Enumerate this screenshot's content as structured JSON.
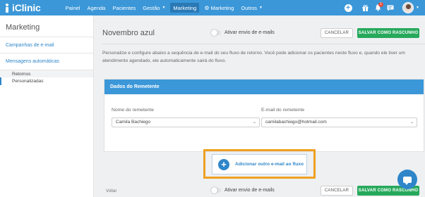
{
  "app": {
    "logo_text": "iClinic"
  },
  "nav": {
    "items": [
      {
        "label": "Painel"
      },
      {
        "label": "Agenda"
      },
      {
        "label": "Pacientes"
      },
      {
        "label": "Gestão"
      },
      {
        "label": "Marketing"
      },
      {
        "label": "Marketing"
      },
      {
        "label": "Outros"
      }
    ],
    "notification_count": "1"
  },
  "sidebar": {
    "title": "Marketing",
    "links": [
      {
        "label": "Campanhas de e-mail"
      },
      {
        "label": "Mensagens automáticas"
      }
    ],
    "subitems": [
      {
        "label": "Retornos"
      },
      {
        "label": "Personalizadas"
      }
    ]
  },
  "main": {
    "title": "Novembro azul",
    "toggle_label": "Ativar envio de e-mails",
    "cancel_label": "CANCELAR",
    "save_label": "SALVAR COMO RASCUNHO",
    "description": "Personalize e configure abaixo a sequência de e-mail do seu fluxo de retorno. Você pode adicionar os pacientes neste fluxo e, quando ele tiver um atendimento agendado, ele automaticamente sairá do fluxo.",
    "sender_card": {
      "title": "Dados do Remetente",
      "name_label": "Nome do remetente",
      "name_value": "Camila Bachiego",
      "email_label": "E-mail do remetente",
      "email_value": "camilabachiego@hotmail.com"
    },
    "add_email_label": "Adicionar outro e-mail ao fluxo",
    "footer": {
      "back_label": "Voltar",
      "toggle_label": "Ativar envio de e-mails",
      "cancel_label": "CANCELAR",
      "save_label": "SALVAR COMO RASCUNHO"
    }
  },
  "colors": {
    "primary": "#3b97d8",
    "link": "#2e86c9",
    "success": "#27a95c",
    "highlight": "#f0a020"
  }
}
